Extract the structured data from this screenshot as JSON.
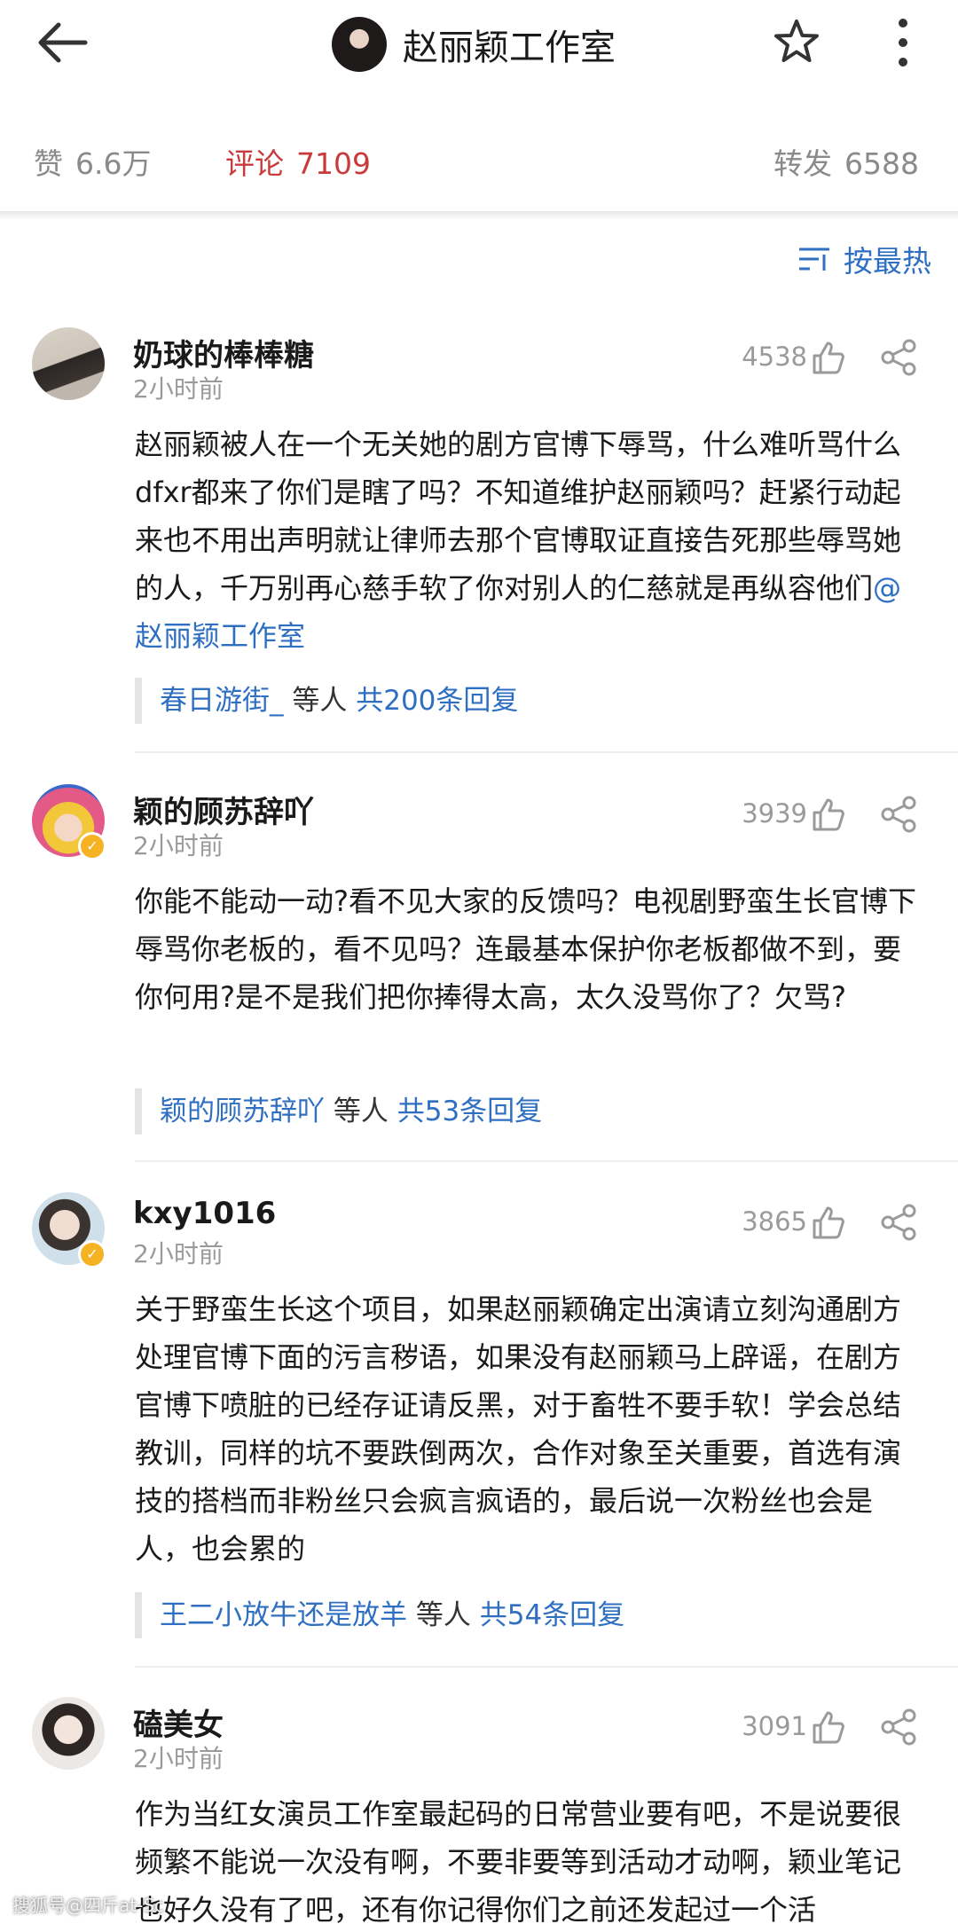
{
  "header": {
    "title": "赵丽颖工作室"
  },
  "stats": {
    "likes_label": "赞",
    "likes_value": "6.6万",
    "comments_label": "评论",
    "comments_value": "7109",
    "reposts_label": "转发",
    "reposts_value": "6588"
  },
  "sort": {
    "label": "按最热"
  },
  "colors": {
    "accent": "#c93b3b",
    "link": "#2f6fc2"
  },
  "comments": [
    {
      "username": "奶球的棒棒糖",
      "time": "2小时前",
      "likes": "4538",
      "text": "赵丽颖被人在一个无关她的剧方官博下辱骂，什么难听骂什么dfxr都来了你们是瞎了吗？不知道维护赵丽颖吗？赶紧行动起来也不用出声明就让律师去那个官博取证直接告死那些辱骂她的人，千万别再心慈手软了你对别人的仁慈就是再纵容他们",
      "mention": "@赵丽颖工作室",
      "reply_user": "春日游街_",
      "reply_mid": " 等人 ",
      "reply_total": "共200条回复"
    },
    {
      "username": "颖的顾苏辞吖",
      "time": "2小时前",
      "likes": "3939",
      "text": "你能不能动一动?看不见大家的反馈吗？电视剧野蛮生长官博下辱骂你老板的，看不见吗？连最基本保护你老板都做不到，要你何用?是不是我们把你捧得太高，太久没骂你了？欠骂?",
      "reply_user": "颖的顾苏辞吖",
      "reply_mid": " 等人 ",
      "reply_total": "共53条回复"
    },
    {
      "username": "kxy1016",
      "time": "2小时前",
      "likes": "3865",
      "text": "关于野蛮生长这个项目，如果赵丽颖确定出演请立刻沟通剧方处理官博下面的污言秽语，如果没有赵丽颖马上辟谣，在剧方官博下喷脏的已经存证请反黑，对于畜牲不要手软！学会总结教训，同样的坑不要跌倒两次，合作对象至关重要，首选有演技的搭档而非粉丝只会疯言疯语的，最后说一次粉丝也会是人，也会累的",
      "reply_user": "王二小放牛还是放羊",
      "reply_mid": " 等人 ",
      "reply_total": "共54条回复"
    },
    {
      "username": "磕美女",
      "time": "2小时前",
      "likes": "3091",
      "text": "作为当红女演员工作室最起码的日常营业要有吧，不是说要很频繁不能说一次没有啊，不要非要等到活动才动啊，颖业笔记也好久没有了吧，还有你记得你们之前还发起过一个活"
    }
  ],
  "watermark": "搜狐号@四斤at-Sc"
}
